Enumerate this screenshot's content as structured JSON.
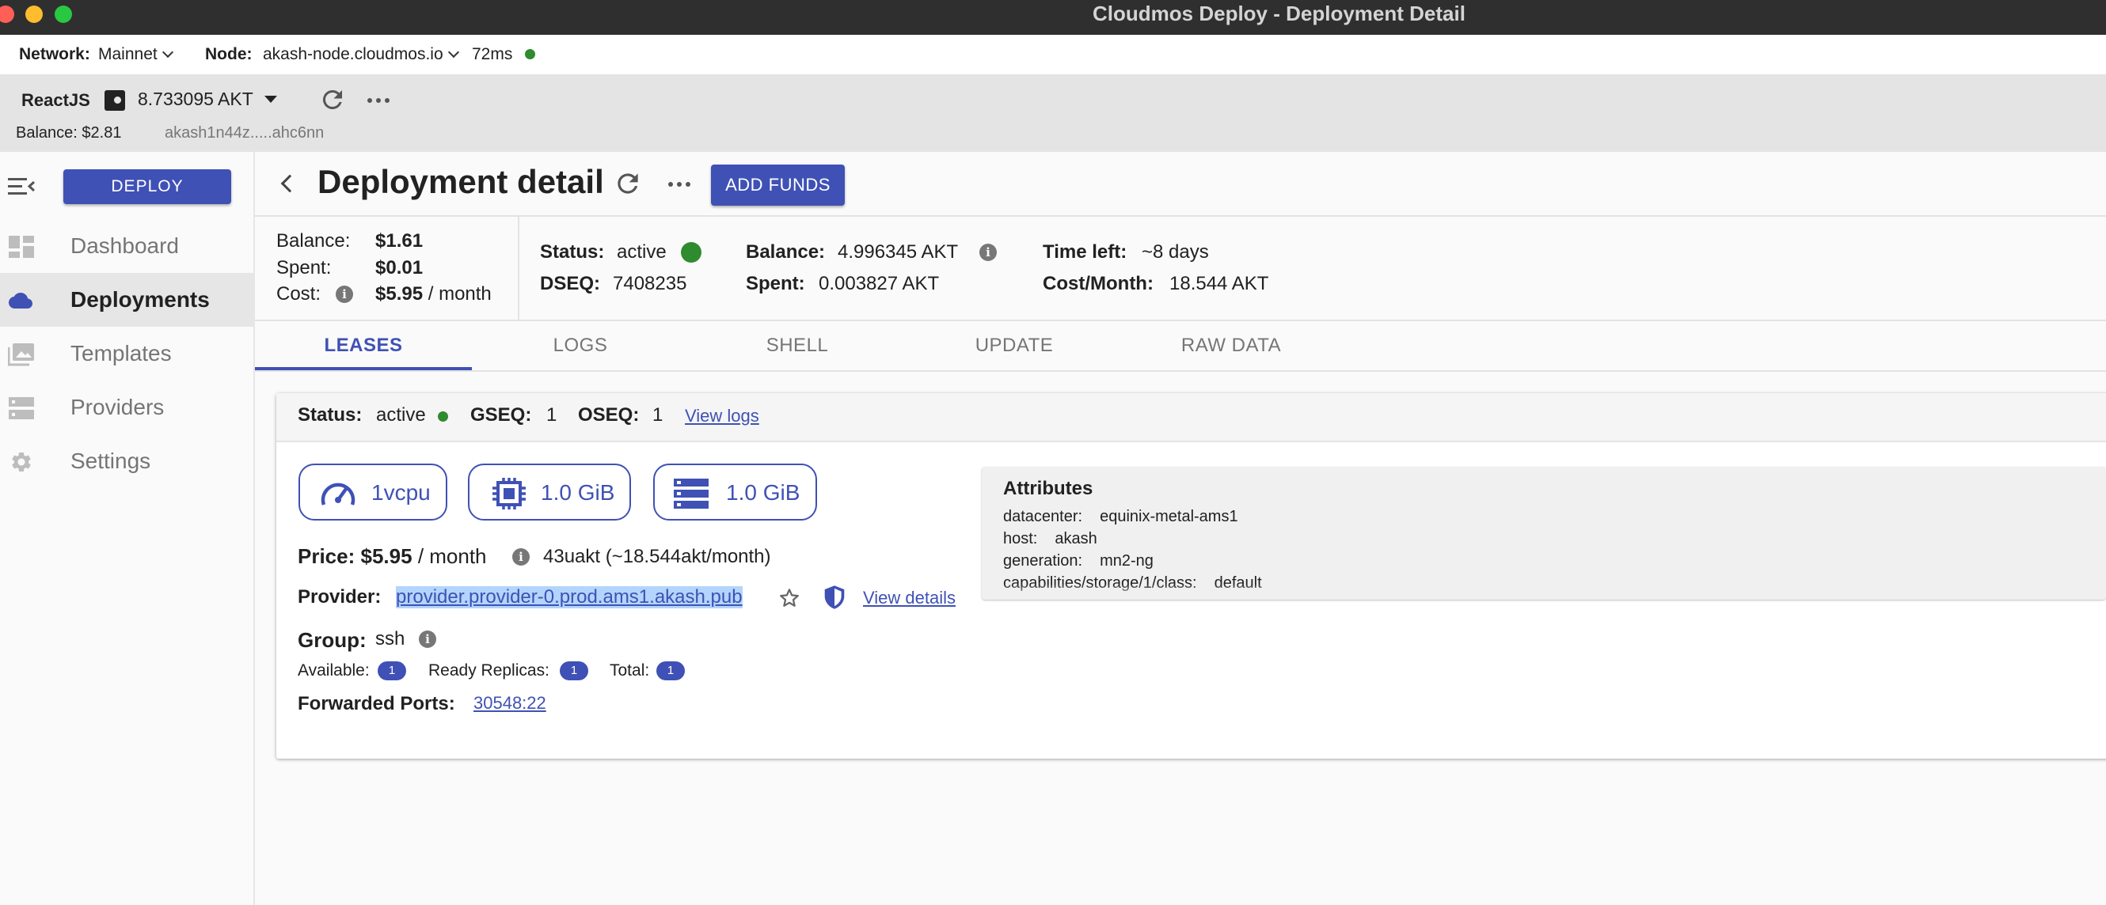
{
  "window": {
    "title": "Cloudmos Deploy - Deployment Detail"
  },
  "network_bar": {
    "network_label": "Network:",
    "network_value": "Mainnet",
    "node_label": "Node:",
    "node_value": "akash-node.cloudmos.io",
    "latency": "72ms",
    "status_color": "#2e8b2e"
  },
  "wallet": {
    "name": "ReactJS",
    "amount": "8.733095 AKT",
    "balance": "Balance: $2.81",
    "address": "akash1n44z.....ahc6nn"
  },
  "sidebar": {
    "deploy_label": "DEPLOY",
    "items": [
      {
        "label": "Dashboard",
        "icon": "dashboard-icon",
        "active": false
      },
      {
        "label": "Deployments",
        "icon": "cloud-icon",
        "active": true
      },
      {
        "label": "Templates",
        "icon": "image-gallery-icon",
        "active": false
      },
      {
        "label": "Providers",
        "icon": "server-icon",
        "active": false
      },
      {
        "label": "Settings",
        "icon": "gear-icon",
        "active": false
      }
    ]
  },
  "header": {
    "title": "Deployment detail",
    "add_funds_label": "ADD FUNDS"
  },
  "summary": {
    "balance_label": "Balance:",
    "balance_value": "$1.61",
    "spent_label": "Spent:",
    "spent_value": "$0.01",
    "cost_label": "Cost:",
    "cost_value": "$5.95",
    "cost_unit": "/ month",
    "status_label": "Status:",
    "status_value": "active",
    "dseq_label": "DSEQ:",
    "dseq_value": "7408235",
    "akt_balance_label": "Balance:",
    "akt_balance_value": "4.996345 AKT",
    "akt_spent_label": "Spent:",
    "akt_spent_value": "0.003827 AKT",
    "time_left_label": "Time left:",
    "time_left_value": "~8 days",
    "cost_month_label": "Cost/Month:",
    "cost_month_value": "18.544 AKT"
  },
  "tabs": [
    {
      "label": "LEASES",
      "active": true
    },
    {
      "label": "LOGS",
      "active": false
    },
    {
      "label": "SHELL",
      "active": false
    },
    {
      "label": "UPDATE",
      "active": false
    },
    {
      "label": "RAW DATA",
      "active": false
    }
  ],
  "lease": {
    "status_label": "Status:",
    "status_value": "active",
    "gseq_label": "GSEQ:",
    "gseq_value": "1",
    "oseq_label": "OSEQ:",
    "oseq_value": "1",
    "view_logs": "View logs",
    "resources": {
      "cpu": "1vcpu",
      "memory": "1.0 GiB",
      "storage": "1.0 GiB"
    },
    "price_label": "Price:",
    "price_value": "$5.95",
    "price_unit": "/ month",
    "price_uakt": "43uakt (~18.544akt/month)",
    "provider_label": "Provider:",
    "provider_value": "provider.provider-0.prod.ams1.akash.pub",
    "view_details": "View details",
    "group_label": "Group:",
    "group_value": "ssh",
    "available_label": "Available:",
    "available_value": "1",
    "ready_label": "Ready Replicas:",
    "ready_value": "1",
    "total_label": "Total:",
    "total_value": "1",
    "ports_label": "Forwarded Ports:",
    "ports_value": "30548:22"
  },
  "attributes": {
    "title": "Attributes",
    "rows": [
      {
        "key": "datacenter:",
        "value": "equinix-metal-ams1"
      },
      {
        "key": "host:",
        "value": "akash"
      },
      {
        "key": "generation:",
        "value": "mn2-ng"
      },
      {
        "key": "capabilities/storage/1/class:",
        "value": "default"
      }
    ]
  },
  "colors": {
    "accent": "#3f51b5",
    "status_active": "#2e8b2e"
  }
}
